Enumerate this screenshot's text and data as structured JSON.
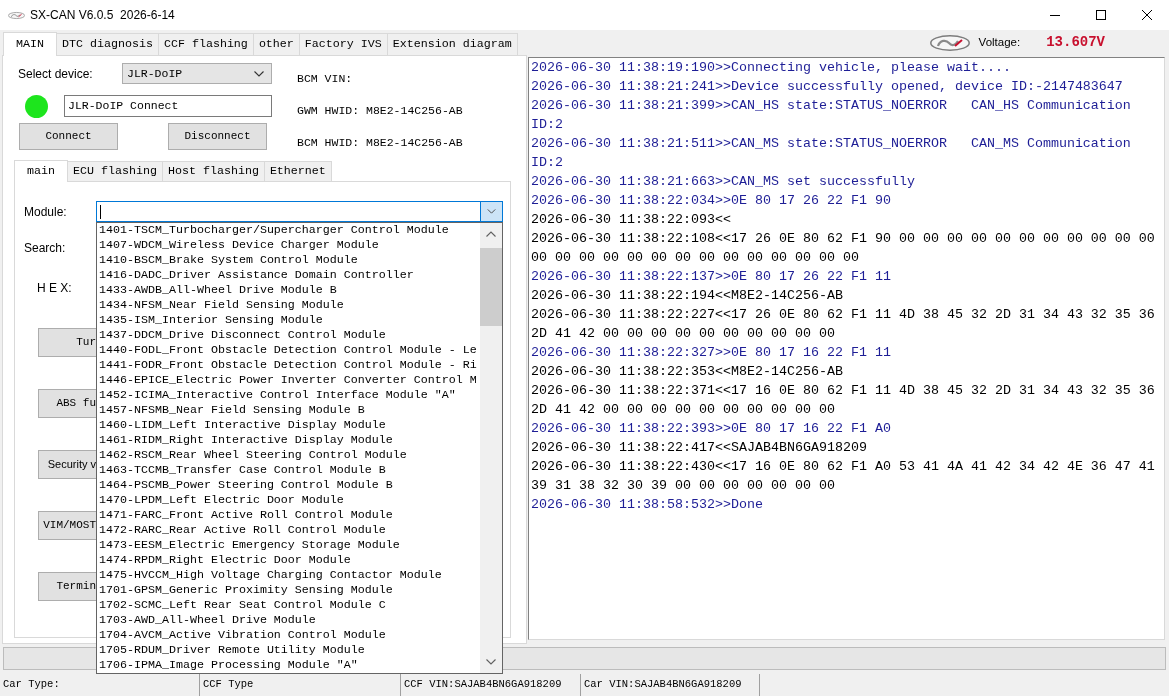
{
  "window": {
    "title": "SX-CAN V6.0.5  2026-6-14"
  },
  "main_tabs": [
    {
      "label": "MAIN",
      "selected": true
    },
    {
      "label": "DTC diagnosis",
      "selected": false
    },
    {
      "label": "CCF flashing",
      "selected": false
    },
    {
      "label": "other",
      "selected": false
    },
    {
      "label": "Factory IVS",
      "selected": false
    },
    {
      "label": "Extension diagram",
      "selected": false
    }
  ],
  "voltage": {
    "label": "Voltage:",
    "value": "13.607V"
  },
  "device": {
    "select_label": "Select device:",
    "select_value": "JLR-DoIP",
    "connected": true,
    "connection_field": "JLR-DoIP Connect",
    "buttons": [
      "Connect",
      "Disconnect"
    ]
  },
  "vehicle_info": [
    "BCM VIN:",
    "GWM HWID: M8E2-14C256-AB",
    "BCM HWID: M8E2-14C256-AB"
  ],
  "sub_tabs": [
    {
      "label": "main",
      "selected": true
    },
    {
      "label": "ECU flashing",
      "selected": false
    },
    {
      "label": "Host flashing",
      "selected": false
    },
    {
      "label": "Ethernet",
      "selected": false
    }
  ],
  "module_selector": {
    "label": "Module:",
    "focused": true,
    "expanded": true,
    "options": [
      {
        "label": "1401-TSCM_Turbocharger/Supercharger Control Module",
        "selected": false
      },
      {
        "label": "1407-WDCM_Wireless Device Charger Module",
        "selected": false
      },
      {
        "label": "1410-BSCM_Brake System Control Module",
        "selected": false
      },
      {
        "label": "1416-DADC_Driver Assistance Domain Controller",
        "selected": false
      },
      {
        "label": "1433-AWDB_All-Wheel Drive Module B",
        "selected": false
      },
      {
        "label": "1434-NFSM_Near Field Sensing Module",
        "selected": false
      },
      {
        "label": "1435-ISM_Interior Sensing Module",
        "selected": false
      },
      {
        "label": "1437-DDCM_Drive Disconnect Control Module",
        "selected": false
      },
      {
        "label": "1440-FODL_Front Obstacle Detection Control Module - Le",
        "selected": false
      },
      {
        "label": "1441-FODR_Front Obstacle Detection Control Module - Ri",
        "selected": false
      },
      {
        "label": "1446-EPICE_Electric Power Inverter Converter Control M",
        "selected": false
      },
      {
        "label": "1452-ICIMA_Interactive Control Interface Module \"A\"",
        "selected": false
      },
      {
        "label": "1457-NFSMB_Near Field Sensing Module B",
        "selected": false
      },
      {
        "label": "1460-LIDM_Left Interactive Display Module",
        "selected": false
      },
      {
        "label": "1461-RIDM_Right Interactive Display Module",
        "selected": false
      },
      {
        "label": "1462-RSCM_Rear Wheel Steering Control Module",
        "selected": false
      },
      {
        "label": "1463-TCCMB_Transfer Case Control Module B",
        "selected": false
      },
      {
        "label": "1464-PSCMB_Power Steering Control Module B",
        "selected": false
      },
      {
        "label": "1470-LPDM_Left Electric Door Module",
        "selected": false
      },
      {
        "label": "1471-FARC_Front Active Roll Control Module",
        "selected": false
      },
      {
        "label": "1472-RARC_Rear Active Roll Control Module",
        "selected": false
      },
      {
        "label": "1473-EESM_Electric Emergency Storage Module",
        "selected": false
      },
      {
        "label": "1474-RPDM_Right Electric Door Module",
        "selected": false
      },
      {
        "label": "1475-HVCCM_High Voltage Charging Contactor Module",
        "selected": false
      },
      {
        "label": "1701-GPSM_Generic Proximity Sensing Module",
        "selected": false
      },
      {
        "label": "1702-SCMC_Left Rear Seat Control Module C",
        "selected": false
      },
      {
        "label": "1703-AWD_All-Wheel Drive Module",
        "selected": false
      },
      {
        "label": "1704-AVCM_Active Vibration Control Module",
        "selected": false
      },
      {
        "label": "1705-RDUM_Driver Remote Utility Module",
        "selected": false
      },
      {
        "label": "1706-IPMA_Image Processing Module \"A\"",
        "selected": false
      }
    ]
  },
  "search_label": "Search:",
  "hex_label": "H E X:",
  "function_buttons": [
    "Tur",
    "ABS fu",
    "Security v",
    "VIM/MOST",
    "Termin"
  ],
  "log": [
    {
      "kind": "outgoing",
      "text": "2026-06-30 11:38:19:190>>Connecting vehicle, please wait...."
    },
    {
      "kind": "outgoing",
      "text": "2026-06-30 11:38:21:241>>Device successfully opened, device ID:-2147483647"
    },
    {
      "kind": "outgoing",
      "text": "2026-06-30 11:38:21:399>>CAN_HS state:STATUS_NOERROR   CAN_HS Communication ID:2"
    },
    {
      "kind": "outgoing",
      "text": "2026-06-30 11:38:21:511>>CAN_MS state:STATUS_NOERROR   CAN_MS Communication ID:2"
    },
    {
      "kind": "outgoing",
      "text": "2026-06-30 11:38:21:663>>CAN_MS set successfully"
    },
    {
      "kind": "outgoing",
      "text": "2026-06-30 11:38:22:034>>0E 80 17 26 22 F1 90"
    },
    {
      "kind": "incoming",
      "text": "2026-06-30 11:38:22:093<<"
    },
    {
      "kind": "incoming",
      "text": "2026-06-30 11:38:22:108<<17 26 0E 80 62 F1 90 00 00 00 00 00 00 00 00 00 00 00 00 00 00 00 00 00 00 00 00 00 00 00 00 00"
    },
    {
      "kind": "outgoing",
      "text": "2026-06-30 11:38:22:137>>0E 80 17 26 22 F1 11"
    },
    {
      "kind": "incoming",
      "text": "2026-06-30 11:38:22:194<<M8E2-14C256-AB"
    },
    {
      "kind": "incoming",
      "text": "2026-06-30 11:38:22:227<<17 26 0E 80 62 F1 11 4D 38 45 32 2D 31 34 43 32 35 36 2D 41 42 00 00 00 00 00 00 00 00 00 00"
    },
    {
      "kind": "outgoing",
      "text": "2026-06-30 11:38:22:327>>0E 80 17 16 22 F1 11"
    },
    {
      "kind": "incoming",
      "text": "2026-06-30 11:38:22:353<<M8E2-14C256-AB"
    },
    {
      "kind": "incoming",
      "text": "2026-06-30 11:38:22:371<<17 16 0E 80 62 F1 11 4D 38 45 32 2D 31 34 43 32 35 36 2D 41 42 00 00 00 00 00 00 00 00 00 00"
    },
    {
      "kind": "outgoing",
      "text": "2026-06-30 11:38:22:393>>0E 80 17 16 22 F1 A0"
    },
    {
      "kind": "incoming",
      "text": "2026-06-30 11:38:22:417<<SAJAB4BN6GA918209"
    },
    {
      "kind": "incoming",
      "text": "2026-06-30 11:38:22:430<<17 16 0E 80 62 F1 A0 53 41 4A 41 42 34 42 4E 36 47 41 39 31 38 32 30 39 00 00 00 00 00 00 00"
    },
    {
      "kind": "outgoing",
      "text": "2026-06-30 11:38:58:532>>Done"
    }
  ],
  "progress": {
    "level": 0
  },
  "status_bar": [
    "Car Type:",
    "CCF Type",
    "CCF VIN:SAJAB4BN6GA918209",
    "Car VIN:SAJAB4BN6GA918209"
  ]
}
